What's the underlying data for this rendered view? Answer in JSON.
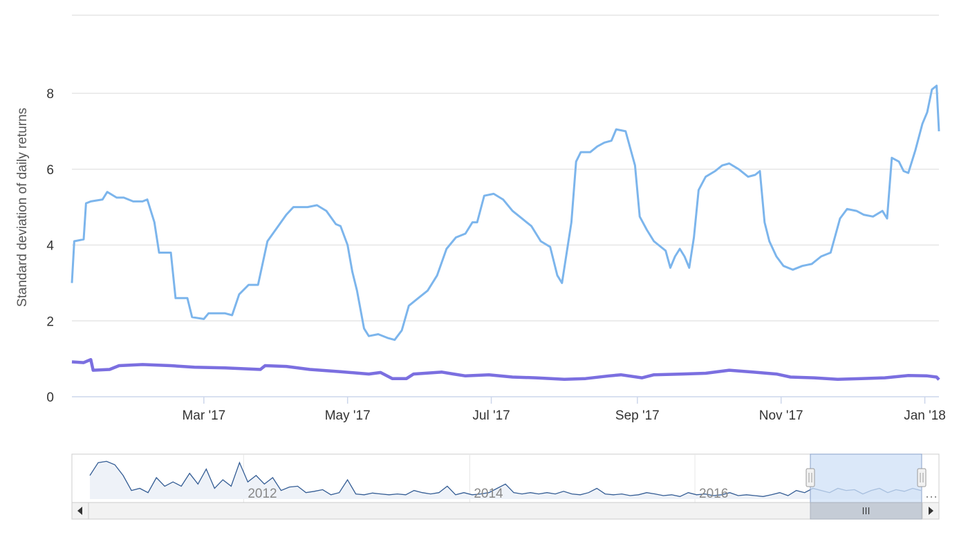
{
  "chart_data": {
    "type": "line",
    "ylabel": "Standard deviation of daily returns",
    "ylim": [
      0,
      8.5
    ],
    "yticks": [
      0,
      2,
      4,
      6,
      8
    ],
    "xlim": [
      "2017-01-04",
      "2018-01-07"
    ],
    "xticks": [
      {
        "date": "2017-03-01",
        "label": "Mar '17"
      },
      {
        "date": "2017-05-01",
        "label": "May '17"
      },
      {
        "date": "2017-07-01",
        "label": "Jul '17"
      },
      {
        "date": "2017-09-01",
        "label": "Sep '17"
      },
      {
        "date": "2017-11-01",
        "label": "Nov '17"
      },
      {
        "date": "2018-01-01",
        "label": "Jan '18"
      }
    ],
    "grid": true,
    "colors": {
      "series_a": "#7cb5ec",
      "series_b": "#7b6fe0",
      "grid": "#e6e6e6",
      "navigator_line": "#335c94",
      "navigator_fill": "#e8eef6",
      "selection": "#cfe0f7"
    },
    "series": [
      {
        "color": "#7cb5ec",
        "points": [
          [
            "2017-01-04",
            3.0
          ],
          [
            "2017-01-05",
            4.1
          ],
          [
            "2017-01-09",
            4.15
          ],
          [
            "2017-01-10",
            5.1
          ],
          [
            "2017-01-12",
            5.15
          ],
          [
            "2017-01-17",
            5.2
          ],
          [
            "2017-01-19",
            5.4
          ],
          [
            "2017-01-23",
            5.25
          ],
          [
            "2017-01-26",
            5.25
          ],
          [
            "2017-01-30",
            5.15
          ],
          [
            "2017-02-03",
            5.15
          ],
          [
            "2017-02-05",
            5.2
          ],
          [
            "2017-02-08",
            4.6
          ],
          [
            "2017-02-10",
            3.8
          ],
          [
            "2017-02-15",
            3.8
          ],
          [
            "2017-02-17",
            2.6
          ],
          [
            "2017-02-22",
            2.6
          ],
          [
            "2017-02-24",
            2.1
          ],
          [
            "2017-03-01",
            2.05
          ],
          [
            "2017-03-03",
            2.2
          ],
          [
            "2017-03-10",
            2.2
          ],
          [
            "2017-03-13",
            2.15
          ],
          [
            "2017-03-16",
            2.7
          ],
          [
            "2017-03-20",
            2.95
          ],
          [
            "2017-03-24",
            2.95
          ],
          [
            "2017-03-28",
            4.1
          ],
          [
            "2017-04-01",
            4.45
          ],
          [
            "2017-04-05",
            4.8
          ],
          [
            "2017-04-08",
            5.0
          ],
          [
            "2017-04-14",
            5.0
          ],
          [
            "2017-04-18",
            5.05
          ],
          [
            "2017-04-22",
            4.9
          ],
          [
            "2017-04-26",
            4.55
          ],
          [
            "2017-04-28",
            4.5
          ],
          [
            "2017-05-01",
            4.0
          ],
          [
            "2017-05-03",
            3.3
          ],
          [
            "2017-05-05",
            2.8
          ],
          [
            "2017-05-08",
            1.8
          ],
          [
            "2017-05-10",
            1.6
          ],
          [
            "2017-05-14",
            1.65
          ],
          [
            "2017-05-18",
            1.55
          ],
          [
            "2017-05-21",
            1.5
          ],
          [
            "2017-05-24",
            1.75
          ],
          [
            "2017-05-27",
            2.4
          ],
          [
            "2017-05-31",
            2.6
          ],
          [
            "2017-06-04",
            2.8
          ],
          [
            "2017-06-08",
            3.2
          ],
          [
            "2017-06-12",
            3.9
          ],
          [
            "2017-06-16",
            4.2
          ],
          [
            "2017-06-20",
            4.3
          ],
          [
            "2017-06-23",
            4.6
          ],
          [
            "2017-06-25",
            4.6
          ],
          [
            "2017-06-28",
            5.3
          ],
          [
            "2017-07-02",
            5.35
          ],
          [
            "2017-07-06",
            5.2
          ],
          [
            "2017-07-10",
            4.9
          ],
          [
            "2017-07-14",
            4.7
          ],
          [
            "2017-07-18",
            4.5
          ],
          [
            "2017-07-22",
            4.1
          ],
          [
            "2017-07-26",
            3.95
          ],
          [
            "2017-07-29",
            3.2
          ],
          [
            "2017-07-31",
            3.0
          ],
          [
            "2017-08-02",
            3.8
          ],
          [
            "2017-08-04",
            4.6
          ],
          [
            "2017-08-06",
            6.2
          ],
          [
            "2017-08-08",
            6.45
          ],
          [
            "2017-08-12",
            6.45
          ],
          [
            "2017-08-15",
            6.6
          ],
          [
            "2017-08-18",
            6.7
          ],
          [
            "2017-08-21",
            6.75
          ],
          [
            "2017-08-23",
            7.05
          ],
          [
            "2017-08-27",
            7.0
          ],
          [
            "2017-08-31",
            6.1
          ],
          [
            "2017-09-02",
            4.75
          ],
          [
            "2017-09-05",
            4.4
          ],
          [
            "2017-09-08",
            4.1
          ],
          [
            "2017-09-10",
            4.0
          ],
          [
            "2017-09-13",
            3.85
          ],
          [
            "2017-09-15",
            3.4
          ],
          [
            "2017-09-17",
            3.7
          ],
          [
            "2017-09-19",
            3.9
          ],
          [
            "2017-09-21",
            3.7
          ],
          [
            "2017-09-23",
            3.4
          ],
          [
            "2017-09-25",
            4.2
          ],
          [
            "2017-09-27",
            5.45
          ],
          [
            "2017-09-30",
            5.8
          ],
          [
            "2017-10-04",
            5.95
          ],
          [
            "2017-10-07",
            6.1
          ],
          [
            "2017-10-10",
            6.15
          ],
          [
            "2017-10-14",
            6.0
          ],
          [
            "2017-10-18",
            5.8
          ],
          [
            "2017-10-21",
            5.85
          ],
          [
            "2017-10-23",
            5.95
          ],
          [
            "2017-10-25",
            4.6
          ],
          [
            "2017-10-27",
            4.1
          ],
          [
            "2017-10-30",
            3.7
          ],
          [
            "2017-11-02",
            3.45
          ],
          [
            "2017-11-06",
            3.35
          ],
          [
            "2017-11-10",
            3.45
          ],
          [
            "2017-11-14",
            3.5
          ],
          [
            "2017-11-18",
            3.7
          ],
          [
            "2017-11-22",
            3.8
          ],
          [
            "2017-11-26",
            4.7
          ],
          [
            "2017-11-29",
            4.95
          ],
          [
            "2017-12-03",
            4.9
          ],
          [
            "2017-12-06",
            4.8
          ],
          [
            "2017-12-10",
            4.75
          ],
          [
            "2017-12-14",
            4.9
          ],
          [
            "2017-12-16",
            4.7
          ],
          [
            "2017-12-18",
            6.3
          ],
          [
            "2017-12-21",
            6.2
          ],
          [
            "2017-12-23",
            5.95
          ],
          [
            "2017-12-25",
            5.9
          ],
          [
            "2017-12-28",
            6.5
          ],
          [
            "2017-12-31",
            7.2
          ],
          [
            "2018-01-02",
            7.5
          ],
          [
            "2018-01-04",
            8.1
          ],
          [
            "2018-01-06",
            8.2
          ],
          [
            "2018-01-07",
            7.0
          ]
        ]
      },
      {
        "color": "#7b6fe0",
        "points": [
          [
            "2017-01-04",
            0.92
          ],
          [
            "2017-01-09",
            0.9
          ],
          [
            "2017-01-12",
            0.98
          ],
          [
            "2017-01-13",
            0.7
          ],
          [
            "2017-01-20",
            0.72
          ],
          [
            "2017-01-24",
            0.82
          ],
          [
            "2017-02-03",
            0.85
          ],
          [
            "2017-02-15",
            0.82
          ],
          [
            "2017-02-25",
            0.78
          ],
          [
            "2017-03-10",
            0.76
          ],
          [
            "2017-03-25",
            0.72
          ],
          [
            "2017-03-27",
            0.82
          ],
          [
            "2017-04-05",
            0.8
          ],
          [
            "2017-04-15",
            0.72
          ],
          [
            "2017-04-28",
            0.66
          ],
          [
            "2017-05-10",
            0.6
          ],
          [
            "2017-05-15",
            0.64
          ],
          [
            "2017-05-20",
            0.48
          ],
          [
            "2017-05-26",
            0.48
          ],
          [
            "2017-05-29",
            0.6
          ],
          [
            "2017-06-10",
            0.65
          ],
          [
            "2017-06-15",
            0.6
          ],
          [
            "2017-06-20",
            0.55
          ],
          [
            "2017-06-30",
            0.58
          ],
          [
            "2017-07-10",
            0.52
          ],
          [
            "2017-07-20",
            0.5
          ],
          [
            "2017-08-01",
            0.46
          ],
          [
            "2017-08-10",
            0.48
          ],
          [
            "2017-08-20",
            0.55
          ],
          [
            "2017-08-25",
            0.58
          ],
          [
            "2017-09-03",
            0.5
          ],
          [
            "2017-09-08",
            0.58
          ],
          [
            "2017-09-20",
            0.6
          ],
          [
            "2017-09-30",
            0.62
          ],
          [
            "2017-10-10",
            0.7
          ],
          [
            "2017-10-20",
            0.65
          ],
          [
            "2017-10-30",
            0.6
          ],
          [
            "2017-11-05",
            0.52
          ],
          [
            "2017-11-15",
            0.5
          ],
          [
            "2017-11-25",
            0.46
          ],
          [
            "2017-12-05",
            0.48
          ],
          [
            "2017-12-15",
            0.5
          ],
          [
            "2017-12-25",
            0.56
          ],
          [
            "2018-01-02",
            0.55
          ],
          [
            "2018-01-06",
            0.52
          ],
          [
            "2018-01-07",
            0.45
          ]
        ]
      }
    ]
  },
  "navigator": {
    "year_labels": [
      "2012",
      "2014",
      "2016"
    ],
    "more_glyph": "…",
    "series_points": [
      [
        0.0,
        0.55
      ],
      [
        0.01,
        0.85
      ],
      [
        0.02,
        0.88
      ],
      [
        0.03,
        0.8
      ],
      [
        0.04,
        0.55
      ],
      [
        0.05,
        0.2
      ],
      [
        0.06,
        0.25
      ],
      [
        0.07,
        0.15
      ],
      [
        0.08,
        0.5
      ],
      [
        0.09,
        0.3
      ],
      [
        0.1,
        0.4
      ],
      [
        0.11,
        0.3
      ],
      [
        0.12,
        0.6
      ],
      [
        0.13,
        0.35
      ],
      [
        0.14,
        0.7
      ],
      [
        0.15,
        0.25
      ],
      [
        0.16,
        0.45
      ],
      [
        0.17,
        0.3
      ],
      [
        0.18,
        0.85
      ],
      [
        0.19,
        0.4
      ],
      [
        0.2,
        0.55
      ],
      [
        0.21,
        0.35
      ],
      [
        0.22,
        0.5
      ],
      [
        0.23,
        0.2
      ],
      [
        0.24,
        0.28
      ],
      [
        0.25,
        0.3
      ],
      [
        0.26,
        0.15
      ],
      [
        0.27,
        0.18
      ],
      [
        0.28,
        0.22
      ],
      [
        0.29,
        0.1
      ],
      [
        0.3,
        0.15
      ],
      [
        0.31,
        0.45
      ],
      [
        0.32,
        0.12
      ],
      [
        0.33,
        0.1
      ],
      [
        0.34,
        0.14
      ],
      [
        0.35,
        0.12
      ],
      [
        0.36,
        0.1
      ],
      [
        0.37,
        0.12
      ],
      [
        0.38,
        0.1
      ],
      [
        0.39,
        0.2
      ],
      [
        0.4,
        0.15
      ],
      [
        0.41,
        0.12
      ],
      [
        0.42,
        0.15
      ],
      [
        0.43,
        0.3
      ],
      [
        0.44,
        0.1
      ],
      [
        0.45,
        0.15
      ],
      [
        0.46,
        0.1
      ],
      [
        0.47,
        0.12
      ],
      [
        0.48,
        0.15
      ],
      [
        0.49,
        0.25
      ],
      [
        0.5,
        0.35
      ],
      [
        0.51,
        0.15
      ],
      [
        0.52,
        0.12
      ],
      [
        0.53,
        0.15
      ],
      [
        0.54,
        0.12
      ],
      [
        0.55,
        0.15
      ],
      [
        0.56,
        0.12
      ],
      [
        0.57,
        0.18
      ],
      [
        0.58,
        0.12
      ],
      [
        0.59,
        0.1
      ],
      [
        0.6,
        0.15
      ],
      [
        0.61,
        0.25
      ],
      [
        0.62,
        0.12
      ],
      [
        0.63,
        0.1
      ],
      [
        0.64,
        0.12
      ],
      [
        0.65,
        0.08
      ],
      [
        0.66,
        0.1
      ],
      [
        0.67,
        0.15
      ],
      [
        0.68,
        0.12
      ],
      [
        0.69,
        0.08
      ],
      [
        0.7,
        0.1
      ],
      [
        0.71,
        0.06
      ],
      [
        0.72,
        0.15
      ],
      [
        0.73,
        0.1
      ],
      [
        0.74,
        0.12
      ],
      [
        0.75,
        0.08
      ],
      [
        0.76,
        0.1
      ],
      [
        0.77,
        0.15
      ],
      [
        0.78,
        0.08
      ],
      [
        0.79,
        0.1
      ],
      [
        0.8,
        0.08
      ],
      [
        0.81,
        0.06
      ],
      [
        0.82,
        0.1
      ],
      [
        0.83,
        0.15
      ],
      [
        0.84,
        0.08
      ],
      [
        0.85,
        0.2
      ],
      [
        0.86,
        0.15
      ],
      [
        0.87,
        0.25
      ],
      [
        0.88,
        0.2
      ],
      [
        0.89,
        0.15
      ],
      [
        0.9,
        0.25
      ],
      [
        0.91,
        0.2
      ],
      [
        0.92,
        0.22
      ],
      [
        0.93,
        0.12
      ],
      [
        0.94,
        0.2
      ],
      [
        0.95,
        0.25
      ],
      [
        0.96,
        0.15
      ],
      [
        0.97,
        0.22
      ],
      [
        0.98,
        0.18
      ],
      [
        0.99,
        0.25
      ],
      [
        1.0,
        0.2
      ]
    ],
    "selection": [
      0.85,
      0.985
    ]
  }
}
